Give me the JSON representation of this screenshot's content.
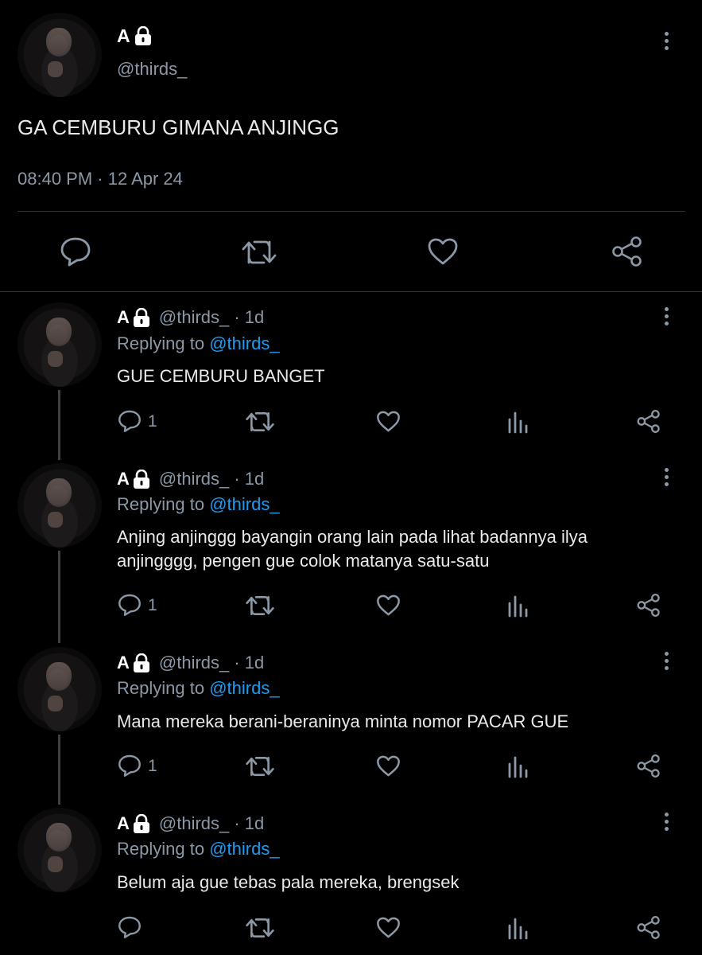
{
  "main_tweet": {
    "name": "A",
    "handle": "@thirds_",
    "text": "GA CEMBURU GIMANA ANJINGG",
    "timestamp": "08:40 PM · 12 Apr 24"
  },
  "replies": [
    {
      "name": "A",
      "handle_time": "@thirds_ · 1d",
      "replying_label": "Replying to",
      "replying_to": "@thirds_",
      "text_lines": [
        "GUE CEMBURU BANGET"
      ],
      "reply_count": "1"
    },
    {
      "name": "A",
      "handle_time": "@thirds_ · 1d",
      "replying_label": "Replying to",
      "replying_to": "@thirds_",
      "text_lines": [
        "Anjing anjinggg bayangin orang lain pada lihat badannya ilya",
        "anjingggg, pengen gue colok matanya satu-satu"
      ],
      "reply_count": "1"
    },
    {
      "name": "A",
      "handle_time": "@thirds_ · 1d",
      "replying_label": "Replying to",
      "replying_to": "@thirds_",
      "text_lines": [
        "Mana mereka berani-beraninya minta nomor PACAR GUE"
      ],
      "reply_count": "1"
    },
    {
      "name": "A",
      "handle_time": "@thirds_ · 1d",
      "replying_label": "Replying to",
      "replying_to": "@thirds_",
      "text_lines": [
        "Belum aja gue tebas pala mereka, brengsek"
      ],
      "reply_count": ""
    }
  ],
  "icons": {
    "lock": "lock-icon",
    "reply": "reply-icon",
    "retweet": "retweet-icon",
    "like": "heart-icon",
    "views": "views-icon",
    "share": "share-icon",
    "more": "more-icon"
  },
  "colors": {
    "background": "#000000",
    "muted": "#8b98a5",
    "link": "#1d9bf0",
    "divider": "#2f3336"
  }
}
